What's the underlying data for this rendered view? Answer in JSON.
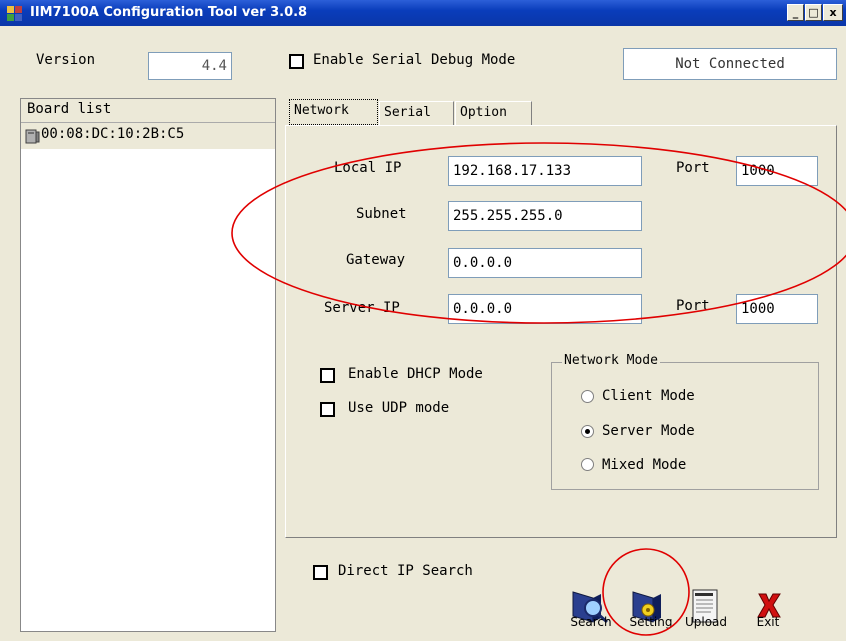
{
  "window": {
    "title": "IIM7100A Configuration Tool ver 3.0.8",
    "minimize": "_",
    "maximize": "□",
    "close": "x"
  },
  "header": {
    "version_label": "Version",
    "version_value": "4.4",
    "serial_debug_label": "Enable Serial Debug Mode",
    "status": "Not Connected"
  },
  "board_list": {
    "title": "Board list",
    "items": [
      "00:08:DC:10:2B:C5"
    ]
  },
  "tabs": [
    "Network",
    "Serial",
    "Option"
  ],
  "network": {
    "local_ip_label": "Local IP",
    "local_ip": "192.168.17.133",
    "port_label": "Port",
    "local_port": "1000",
    "subnet_label": "Subnet",
    "subnet": "255.255.255.0",
    "gateway_label": "Gateway",
    "gateway": "0.0.0.0",
    "server_ip_label": "Server IP",
    "server_ip": "0.0.0.0",
    "server_port": "1000",
    "dhcp_label": "Enable DHCP Mode",
    "udp_label": "Use UDP mode",
    "mode_group": "Network Mode",
    "modes": [
      "Client Mode",
      "Server Mode",
      "Mixed Mode"
    ],
    "selected_mode": "Server Mode"
  },
  "footer": {
    "direct_ip_label": "Direct IP Search"
  },
  "toolbar": {
    "search": "Search",
    "setting": "Setting",
    "upload": "Upload",
    "exit": "Exit"
  },
  "annotation_color": "#e00000"
}
